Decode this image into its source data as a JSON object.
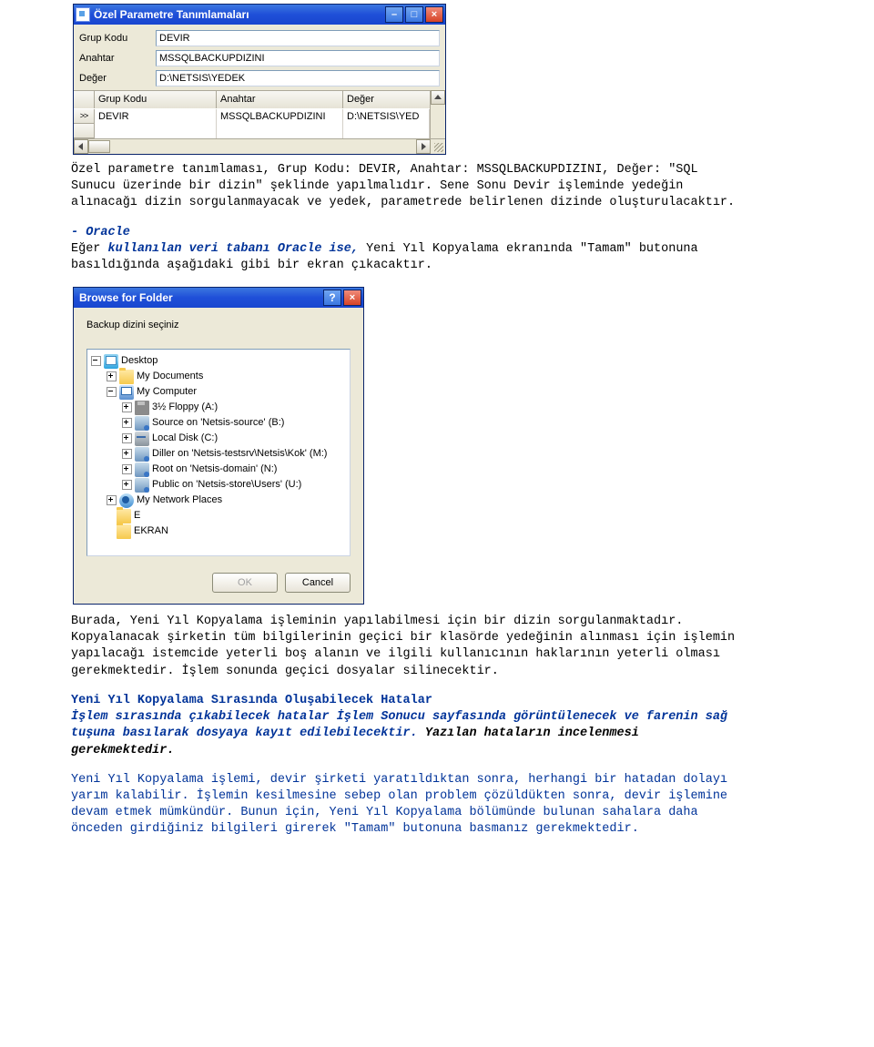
{
  "shot1": {
    "title": "Özel Parametre Tanımlamaları",
    "labels": {
      "grup": "Grup Kodu",
      "anahtar": "Anahtar",
      "deger": "Değer"
    },
    "values": {
      "grup": "DEVIR",
      "anahtar": "MSSQLBACKUPDIZINI",
      "deger": "D:\\NETSIS\\YEDEK"
    },
    "grid": {
      "headers": {
        "c2": "Grup Kodu",
        "c3": "Anahtar",
        "c4": "Değer"
      },
      "row_marker": ">>",
      "row": {
        "c2": "DEVIR",
        "c3": "MSSQLBACKUPDIZINI",
        "c4": "D:\\NETSIS\\YED"
      }
    }
  },
  "para1": "Özel parametre tanımlaması, Grup Kodu: DEVIR, Anahtar: MSSQLBACKUPDIZINI, Değer: \"SQL Sunucu üzerinde bir dizin\" şeklinde yapılmalıdır. Sene Sonu Devir işleminde yedeğin alınacağı dizin sorgulanmayacak ve yedek, parametrede belirlenen dizinde oluşturulacaktır.",
  "oracle_head": "- Oracle",
  "oracle_line": {
    "a": "Eğer ",
    "b": "kullanılan veri tabanı Oracle ise,",
    "c": " Yeni Yıl Kopyalama ekranında \"Tamam\" butonuna basıldığında aşağıdaki gibi bir ekran çıkacaktır."
  },
  "shot2": {
    "title": "Browse for Folder",
    "instr": "Backup dizini seçiniz",
    "tree": {
      "desktop": "Desktop",
      "mydocs": "My Documents",
      "mycomp": "My Computer",
      "floppy": "3½ Floppy (A:)",
      "sourceB": "Source on 'Netsis-source' (B:)",
      "localC": "Local Disk (C:)",
      "dillerM": "Diller on 'Netsis-testsrv\\Netsis\\Kok' (M:)",
      "rootN": "Root on 'Netsis-domain' (N:)",
      "publicU": "Public on 'Netsis-store\\Users' (U:)",
      "netplaces": "My Network Places",
      "E": "E",
      "EKRAN": "EKRAN"
    },
    "ok": "OK",
    "cancel": "Cancel"
  },
  "para2": "Burada, Yeni Yıl Kopyalama işleminin yapılabilmesi için bir dizin sorgulanmaktadır. Kopyalanacak şirketin tüm bilgilerinin geçici bir klasörde yedeğinin alınması için işlemin yapılacağı istemcide yeterli boş alanın ve ilgili kullanıcının haklarının yeterli olması gerekmektedir. İşlem sonunda geçici dosyalar silinecektir.",
  "errhead": "Yeni Yıl Kopyalama Sırasında Oluşabilecek Hatalar",
  "errline": {
    "a": "İşlem sırasında çıkabilecek hatalar İşlem Sonucu sayfasında görüntülenecek ve farenin sağ tuşuna basılarak dosyaya kayıt edilebilecektir.",
    "b": " Yazılan hataların incelenmesi gerekmektedir."
  },
  "para3": "Yeni Yıl Kopyalama işlemi, devir şirketi yaratıldıktan sonra, herhangi bir hatadan dolayı yarım kalabilir. İşlemin kesilmesine sebep olan problem çözüldükten sonra, devir işlemine devam etmek mümkündür. Bunun için, Yeni Yıl Kopyalama bölümünde bulunan sahalara daha önceden girdiğiniz bilgileri girerek \"Tamam\" butonuna basmanız gerekmektedir."
}
